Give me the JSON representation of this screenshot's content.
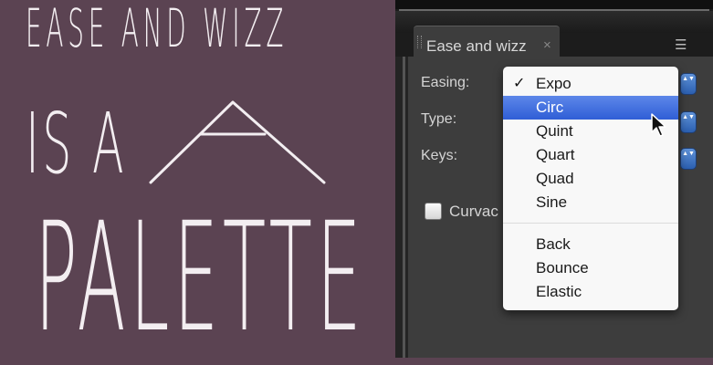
{
  "title_art": {
    "line1": "EASE AND WIZZ",
    "line2": "IS A",
    "line4": "PALETTE"
  },
  "panel": {
    "tab_title": "Ease and wizz",
    "tab_close": "×",
    "menu_icon": "☰",
    "fields": {
      "easing_label": "Easing:",
      "type_label": "Type:",
      "keys_label": "Keys:",
      "curvature_label": "Curvac"
    },
    "stepper_glyph": "▲▼"
  },
  "easing_menu": {
    "selected": "Expo",
    "check_mark": "✓",
    "highlighted": "Circ",
    "group1": [
      "Expo",
      "Circ",
      "Quint",
      "Quart",
      "Quad",
      "Sine"
    ],
    "group2": [
      "Back",
      "Bounce",
      "Elastic"
    ]
  },
  "colors": {
    "background": "#5b4352",
    "title_text": "#f3eef1",
    "panel": "#3d3d3d",
    "highlight": "#3a6be0"
  },
  "icons": {
    "tab_close": "close-icon",
    "panel_menu": "panel-menu-icon",
    "stepper": "stepper-arrows-icon",
    "cursor": "mouse-cursor-icon"
  }
}
